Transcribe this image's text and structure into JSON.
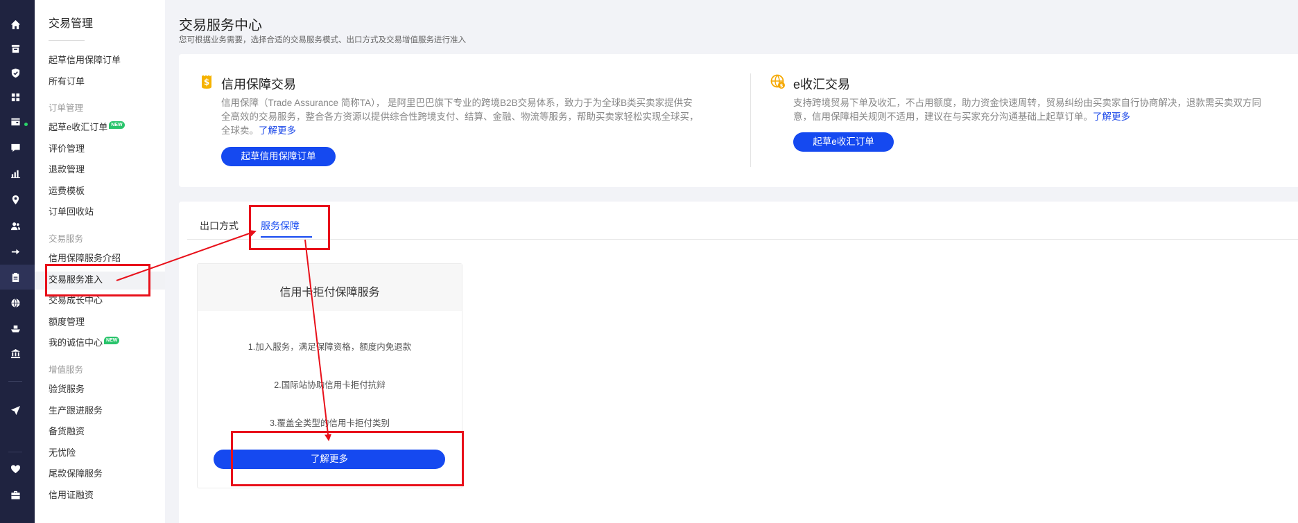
{
  "rail": {
    "icons": [
      "home-icon",
      "store-icon",
      "shield-icon",
      "grid-icon",
      "wallet-icon",
      "chat-icon",
      "chart-icon",
      "location-icon",
      "users-icon",
      "flow-icon",
      "clipboard-icon",
      "globe-icon",
      "boat-icon",
      "bank-icon",
      "send-icon",
      "heart-icon",
      "briefcase-icon"
    ]
  },
  "sidebar": {
    "title": "交易管理",
    "items": [
      {
        "label": "起草信用保障订单"
      },
      {
        "label": "所有订单"
      },
      {
        "label": "订单管理",
        "group": true
      },
      {
        "label": "起草e收汇订单",
        "badge": "NEW"
      },
      {
        "label": "评价管理"
      },
      {
        "label": "退款管理"
      },
      {
        "label": "运费模板"
      },
      {
        "label": "订单回收站"
      },
      {
        "label": "交易服务",
        "group": true
      },
      {
        "label": "信用保障服务介绍"
      },
      {
        "label": "交易服务准入",
        "active": true
      },
      {
        "label": "交易成长中心"
      },
      {
        "label": "额度管理"
      },
      {
        "label": "我的诚信中心",
        "badge": "NEW"
      },
      {
        "label": "增值服务",
        "group": true
      },
      {
        "label": "验货服务"
      },
      {
        "label": "生产跟进服务"
      },
      {
        "label": "备货融资"
      },
      {
        "label": "无忧险"
      },
      {
        "label": "尾款保障服务"
      },
      {
        "label": "信用证融资"
      }
    ]
  },
  "header": {
    "title": "交易服务中心",
    "subtitle": "您可根据业务需要，选择合适的交易服务模式、出口方式及交易增值服务进行准入"
  },
  "features": [
    {
      "title": "信用保障交易",
      "desc_line1": "信用保障（Trade Assurance 简称TA）， 是阿里巴巴旗下专业的跨境B2B交易体系，致力于为全球B类买卖家提供安",
      "desc_line2": "全高效的交易服务，整合各方资源以提供综合性跨境支付、结算、金融、物流等服务，帮助买卖家轻松实现全球买，",
      "desc_line3": "全球卖。",
      "more": "了解更多",
      "button": "起草信用保障订单",
      "icon": "dollar-badge-icon"
    },
    {
      "title": "e收汇交易",
      "desc_line1": "支持跨境贸易下单及收汇，不占用额度，助力资金快速周转，贸易纠纷由买卖家自行协商解决，退款需买卖双方同",
      "desc_line2": "意，信用保障相关规则不适用，建议在与买家充分沟通基础上起草订单。",
      "more": "了解更多",
      "button": "起草e收汇订单",
      "icon": "globe-coin-icon"
    }
  ],
  "tabs": [
    {
      "label": "出口方式",
      "active": false
    },
    {
      "label": "服务保障",
      "active": true
    }
  ],
  "service_card": {
    "title": "信用卡拒付保障服务",
    "lines": [
      "1.加入服务，满足保障资格，额度内免退款",
      "2.国际站协助信用卡拒付抗辩",
      "3.覆盖全类型的信用卡拒付类别"
    ],
    "button": "了解更多"
  },
  "colors": {
    "rail_bg": "#1f2340",
    "accent": "#1549f0",
    "link": "#1a47e8",
    "annotation_red": "#e8101a",
    "new_badge": "#29c46b"
  }
}
